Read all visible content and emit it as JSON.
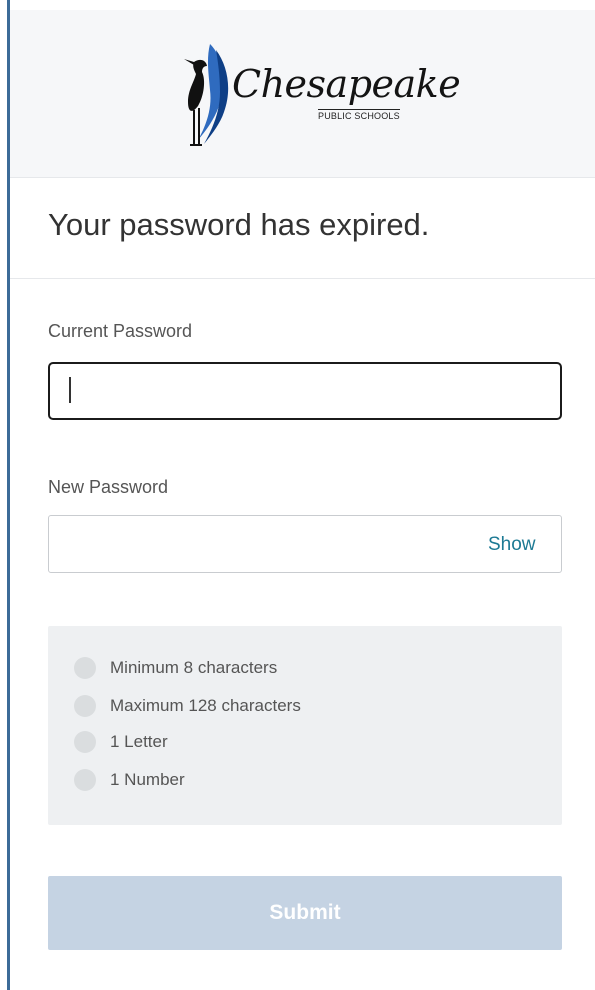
{
  "brand": {
    "logo_word": "Chesapeake",
    "logo_sub": "PUBLIC SCHOOLS",
    "colors": {
      "accent_blue": "#3c6b98",
      "link": "#1d7a94",
      "submit_disabled": "#c5d3e3"
    }
  },
  "page": {
    "title": "Your password has expired."
  },
  "form": {
    "current_password": {
      "label": "Current Password",
      "value": "",
      "placeholder": ""
    },
    "new_password": {
      "label": "New Password",
      "value": "",
      "placeholder": "",
      "show_label": "Show"
    },
    "requirements": [
      {
        "label": "Minimum 8 characters",
        "met": false
      },
      {
        "label": "Maximum 128 characters",
        "met": false
      },
      {
        "label": "1 Letter",
        "met": false
      },
      {
        "label": "1 Number",
        "met": false
      }
    ],
    "submit_label": "Submit",
    "submit_enabled": false
  },
  "icons": {
    "logo": "heron-bird-icon",
    "requirement_status": "circle-icon"
  }
}
